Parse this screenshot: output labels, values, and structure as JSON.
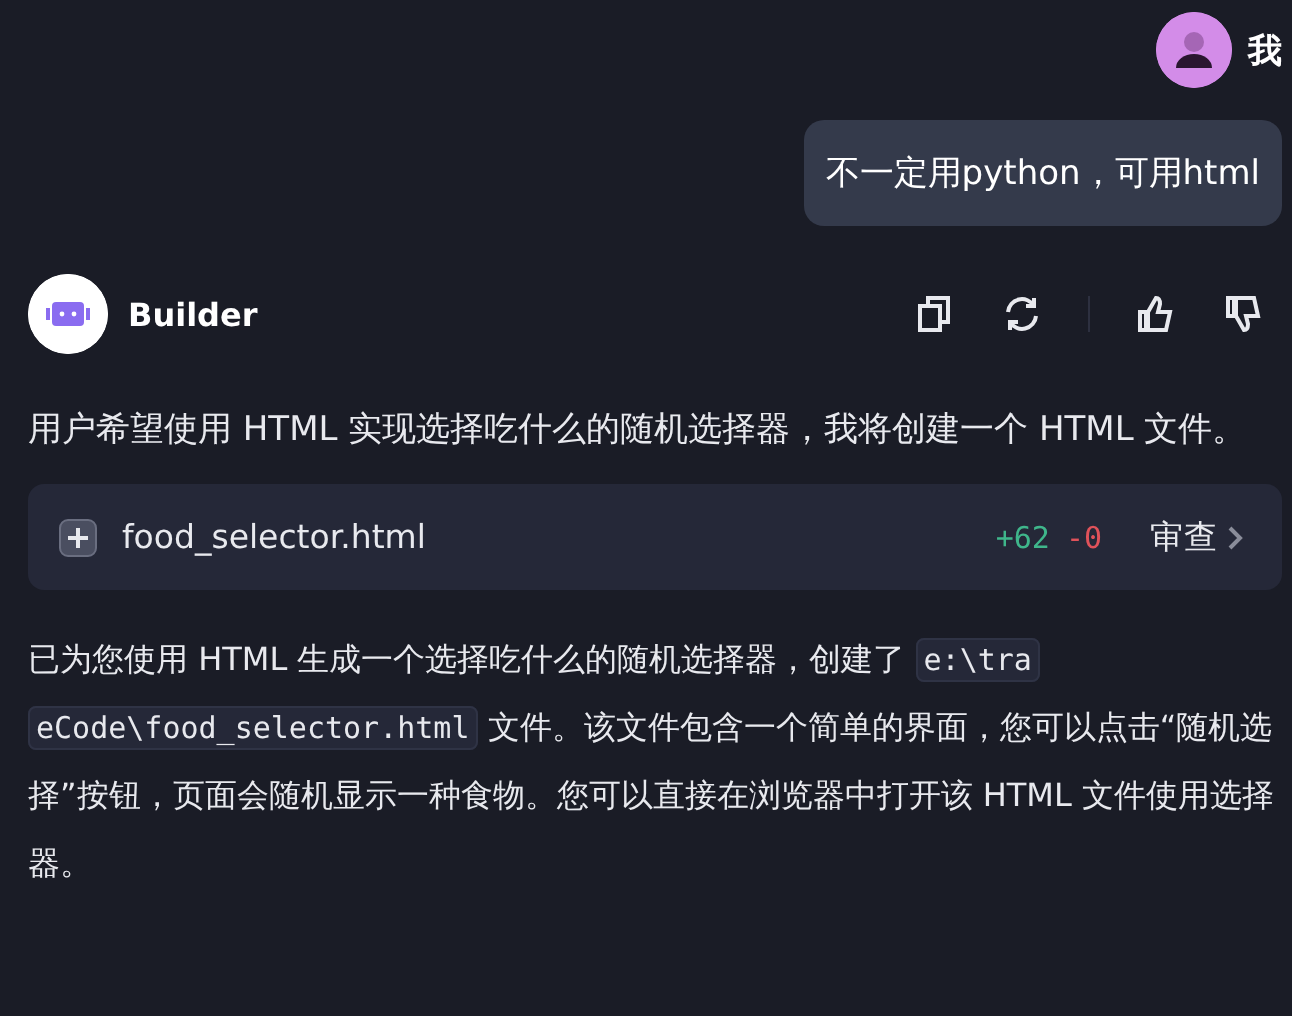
{
  "user": {
    "name": "我",
    "message": "不一定用python，可用html"
  },
  "assistant": {
    "name": "Builder",
    "intro": "用户希望使用 HTML 实现选择吃什么的随机选择器，我将创建一个 HTML 文件。",
    "file": {
      "name": "food_selector.html",
      "added": "+62",
      "removed": "-0",
      "action": "审查"
    },
    "reply": [
      {
        "kind": "text",
        "text": "已为您使用 HTML 生成一个选择吃什么的随机选择器，创建了 "
      },
      {
        "kind": "code",
        "text": "e:\\tra"
      },
      {
        "kind": "code",
        "text": "eCode\\food_selector.html"
      },
      {
        "kind": "text",
        "text": " 文件。该文件包含一个简单的界面，您可以点击“随机选择”按钮，页面会随机显示一种食物。您可以直接在浏览器中打开该 HTML 文件使用选择器。"
      }
    ]
  }
}
